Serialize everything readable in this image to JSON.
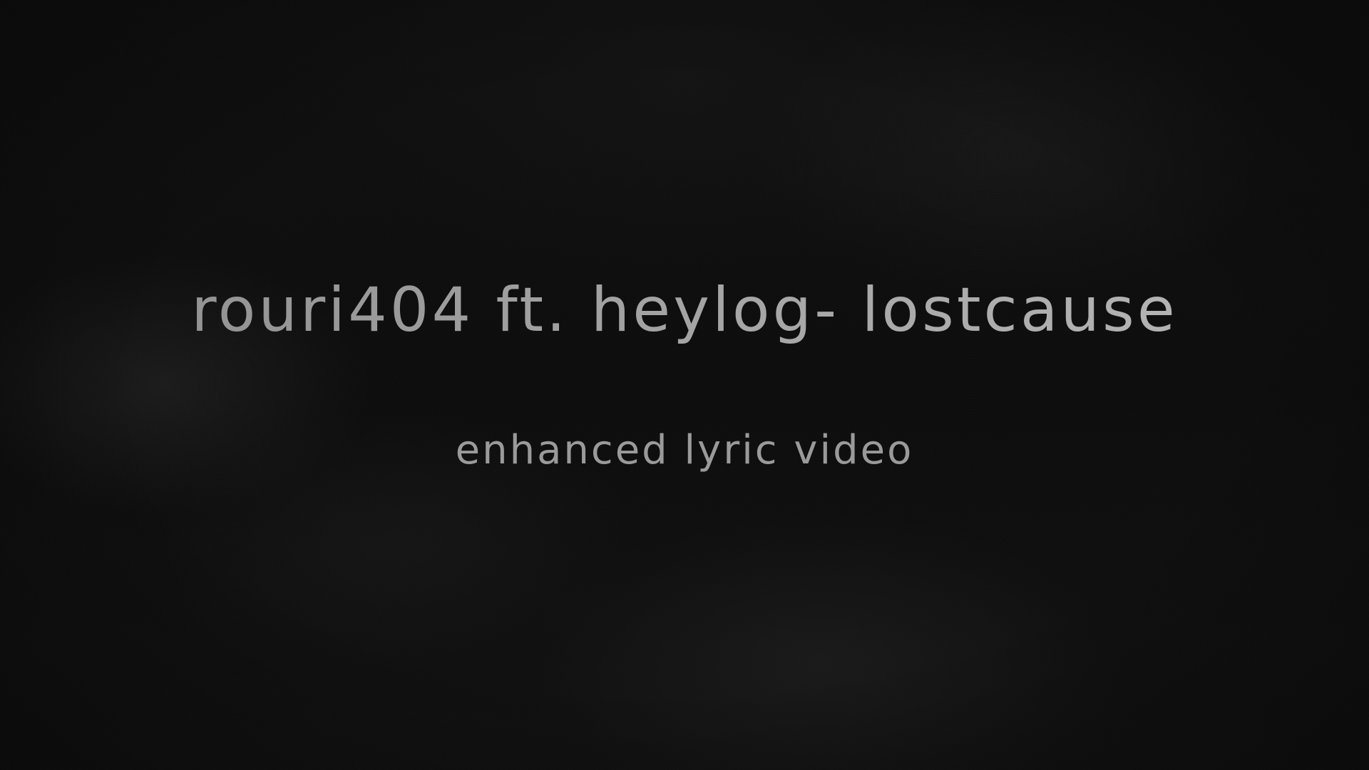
{
  "video": {
    "title": "rouri404 ft. heylog- lostcause",
    "subtitle": "enhanced lyric video"
  },
  "colors": {
    "background": "#0e0e0e",
    "title_text": "#a2a2a2",
    "subtitle_text": "#9a9a9a"
  }
}
